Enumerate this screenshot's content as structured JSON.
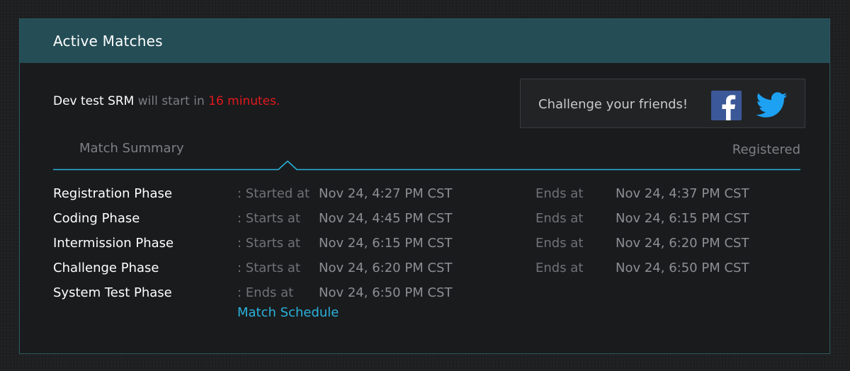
{
  "panel": {
    "title": "Active Matches"
  },
  "status": {
    "match_name": "Dev test SRM",
    "will_start_text": " will start in ",
    "countdown": "16 minutes."
  },
  "challenge": {
    "text": "Challenge your friends!",
    "facebook_icon": "facebook-icon",
    "twitter_icon": "twitter-icon"
  },
  "tabs": {
    "summary": "Match Summary",
    "schedule": "Match Schedule",
    "registered": "Registered",
    "active": "Match Schedule"
  },
  "schedule": [
    {
      "phase": "Registration Phase",
      "start_label": ": Started at",
      "start_time": "Nov 24, 4:27 PM CST",
      "end_label": "Ends at",
      "end_time": "Nov 24, 4:37 PM CST"
    },
    {
      "phase": "Coding Phase",
      "start_label": ": Starts at",
      "start_time": "Nov 24, 4:45 PM CST",
      "end_label": "Ends at",
      "end_time": "Nov 24, 6:15 PM CST"
    },
    {
      "phase": "Intermission Phase",
      "start_label": ": Starts at",
      "start_time": "Nov 24, 6:15 PM CST",
      "end_label": "Ends at",
      "end_time": "Nov 24, 6:20 PM CST"
    },
    {
      "phase": "Challenge Phase",
      "start_label": ": Starts at",
      "start_time": "Nov 24, 6:20 PM CST",
      "end_label": "Ends at",
      "end_time": "Nov 24, 6:50 PM CST"
    },
    {
      "phase": "System Test Phase",
      "start_label": ": Ends at",
      "start_time": "Nov 24, 6:50 PM CST",
      "end_label": "",
      "end_time": ""
    }
  ],
  "colors": {
    "header_bg": "#244d56",
    "accent": "#2ab2dc",
    "countdown": "#e3191d",
    "facebook": "#3b5998",
    "twitter": "#1da1f2"
  }
}
